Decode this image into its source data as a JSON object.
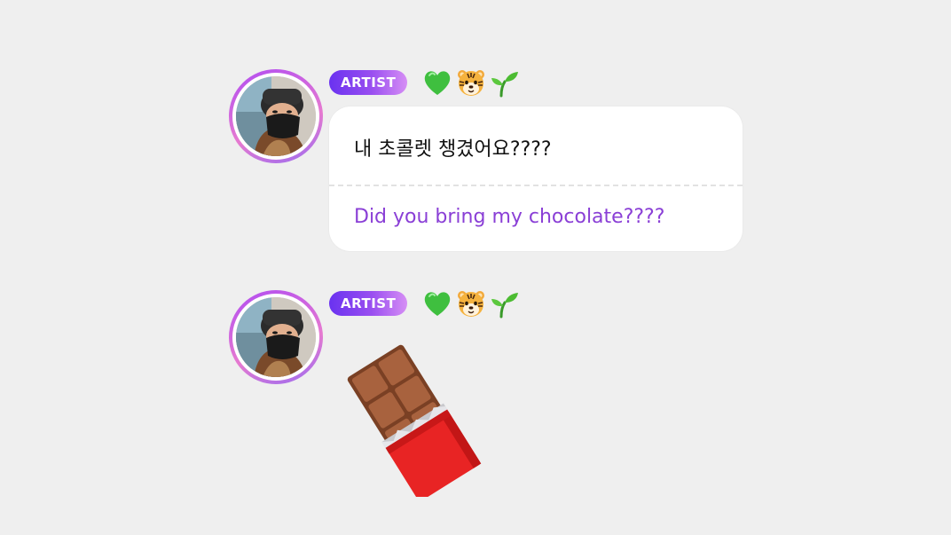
{
  "messages": [
    {
      "badge": "ARTIST",
      "emojis": [
        "green-heart-emoji",
        "tiger-face-emoji",
        "seedling-emoji"
      ],
      "original_text": "내 초콜렛 챙겼어요????",
      "translation_text": "Did you bring my chocolate????"
    },
    {
      "badge": "ARTIST",
      "emojis": [
        "green-heart-emoji",
        "tiger-face-emoji",
        "seedling-emoji"
      ],
      "sticker": "chocolate-bar-emoji"
    }
  ],
  "colors": {
    "background": "#efefef",
    "badge_start": "#6a32f0",
    "badge_end": "#d68ef5",
    "translation_text": "#8a3fd6",
    "avatar_ring": "#b14cf2"
  }
}
